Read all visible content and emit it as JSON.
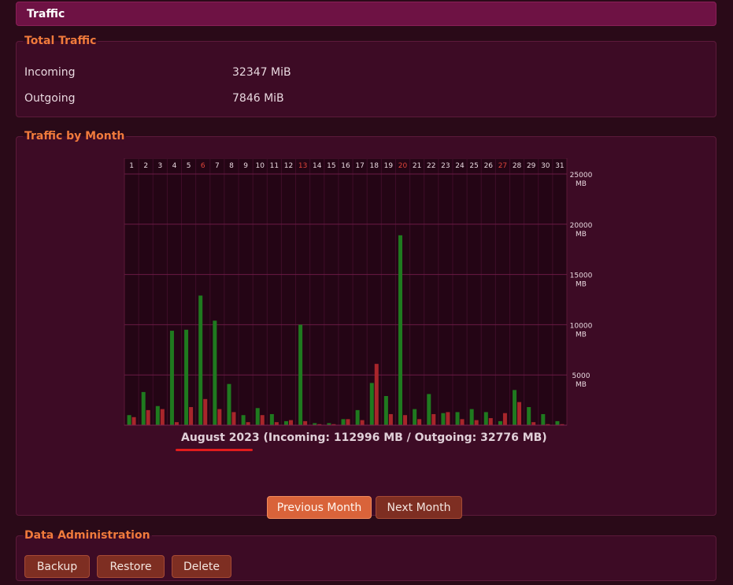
{
  "header": {
    "title": "Traffic"
  },
  "total_traffic": {
    "legend": "Total Traffic",
    "rows": [
      {
        "label": "Incoming",
        "value": "32347 MiB"
      },
      {
        "label": "Outgoing",
        "value": "7846 MiB"
      }
    ]
  },
  "traffic_by_month": {
    "legend": "Traffic by Month",
    "caption_month": "August 2023",
    "caption_totals": " (Incoming: 112996 MB / Outgoing: 32776 MB)",
    "buttons": {
      "previous": "Previous Month",
      "next": "Next Month"
    }
  },
  "data_admin": {
    "legend": "Data Administration",
    "buttons": {
      "backup": "Backup",
      "restore": "Restore",
      "delete": "Delete"
    }
  },
  "colors": {
    "incoming": "#1f7a1f",
    "outgoing": "#a8262b",
    "weekend_day": "#e0443a",
    "weekday": "#e8d8df",
    "gridline": "#6a1a45",
    "accent": "#f07a3c"
  },
  "chart_data": {
    "type": "bar",
    "title": "",
    "x": [
      1,
      2,
      3,
      4,
      5,
      6,
      7,
      8,
      9,
      10,
      11,
      12,
      13,
      14,
      15,
      16,
      17,
      18,
      19,
      20,
      21,
      22,
      23,
      24,
      25,
      26,
      27,
      28,
      29,
      30,
      31
    ],
    "weekend_days": [
      6,
      13,
      20,
      27
    ],
    "ylim": [
      0,
      25000
    ],
    "yticks": [
      {
        "value": 5000,
        "label": "5000",
        "unit": "MB"
      },
      {
        "value": 10000,
        "label": "10000",
        "unit": "MB"
      },
      {
        "value": 15000,
        "label": "15000",
        "unit": "MB"
      },
      {
        "value": 20000,
        "label": "20000",
        "unit": "MB"
      },
      {
        "value": 25000,
        "label": "25000",
        "unit": "MB"
      }
    ],
    "series": [
      {
        "values": [
          1000,
          3300,
          1900,
          9400,
          9500,
          12900,
          10400,
          4100,
          1000,
          1700,
          1100,
          400,
          10000,
          200,
          200,
          600,
          1500,
          4200,
          2900,
          18900,
          1600,
          3100,
          1200,
          1300,
          1600,
          1300,
          400,
          3500,
          1800,
          1100,
          400
        ],
        "color": "#1f7a1f"
      },
      {
        "values": [
          800,
          1500,
          1600,
          300,
          1800,
          2600,
          1600,
          1300,
          300,
          1000,
          300,
          500,
          400,
          100,
          100,
          600,
          500,
          6100,
          1100,
          1000,
          600,
          1100,
          1300,
          600,
          500,
          700,
          1200,
          2300,
          300,
          100,
          100
        ],
        "color": "#a8262b"
      }
    ]
  }
}
